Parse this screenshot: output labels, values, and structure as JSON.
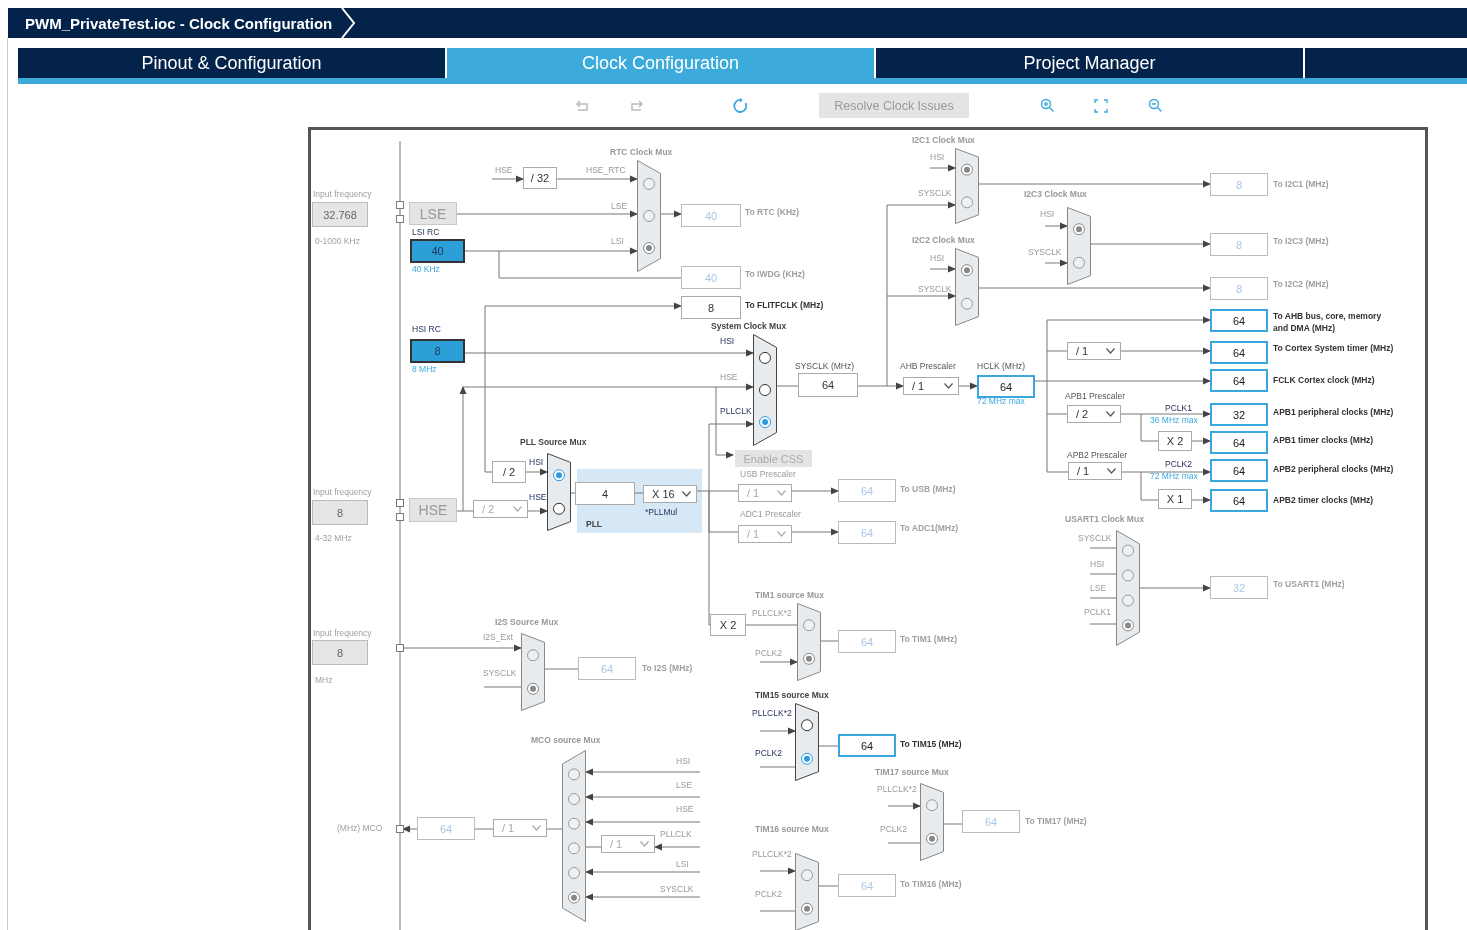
{
  "window": {
    "title": "PWM_PrivateTest.ioc - Clock Configuration"
  },
  "tabs": [
    {
      "label": "Pinout & Configuration",
      "selected": false
    },
    {
      "label": "Clock Configuration",
      "selected": true
    },
    {
      "label": "Project Manager",
      "selected": false
    }
  ],
  "toolbar": {
    "resolve_button": {
      "label": "Resolve Clock Issues",
      "disabled": true
    }
  },
  "diagram": {
    "labels": [
      {
        "text": "Input frequency",
        "kind": "hint"
      },
      {
        "text": "0-1000 KHz",
        "kind": "hint"
      },
      {
        "text": "RTC Clock Mux",
        "kind": "heading",
        "active": false
      },
      {
        "text": "HSE",
        "kind": "signal",
        "active": false
      },
      {
        "text": "HSE_RTC",
        "kind": "signal",
        "active": false
      },
      {
        "text": "LSE",
        "kind": "signal",
        "active": false
      },
      {
        "text": "LSI RC",
        "kind": "signal",
        "active": true
      },
      {
        "text": "LSI",
        "kind": "signal",
        "active": false
      },
      {
        "text": "40 KHz",
        "kind": "note"
      },
      {
        "text": "To RTC (KHz)",
        "kind": "dest",
        "active": false
      },
      {
        "text": "To IWDG (KHz)",
        "kind": "dest",
        "active": false
      },
      {
        "text": "To FLITFCLK (MHz)",
        "kind": "dest",
        "active": true
      },
      {
        "text": "HSI RC",
        "kind": "signal",
        "active": true
      },
      {
        "text": "System Clock Mux",
        "kind": "heading",
        "active": true
      },
      {
        "text": "8 MHz",
        "kind": "note"
      },
      {
        "text": "HSI",
        "kind": "signal",
        "active": true
      },
      {
        "text": "HSE",
        "kind": "signal",
        "active": false
      },
      {
        "text": "PLLCLK",
        "kind": "signal",
        "active": true
      },
      {
        "text": "SYSCLK (MHz)",
        "kind": "caption",
        "active": true
      },
      {
        "text": "AHB Prescaler",
        "kind": "caption",
        "active": true
      },
      {
        "text": "HCLK (MHz)",
        "kind": "caption",
        "active": true
      },
      {
        "text": "72 MHz max",
        "kind": "note"
      },
      {
        "text": "I2C1 Clock Mux",
        "kind": "heading",
        "active": false
      },
      {
        "text": "HSI",
        "kind": "signal",
        "active": false
      },
      {
        "text": "SYSCLK",
        "kind": "signal",
        "active": false
      },
      {
        "text": "I2C2 Clock Mux",
        "kind": "heading",
        "active": false
      },
      {
        "text": "HSI",
        "kind": "signal",
        "active": false
      },
      {
        "text": "SYSCLK",
        "kind": "signal",
        "active": false
      },
      {
        "text": "I2C3 Clock Mux",
        "kind": "heading",
        "active": false
      },
      {
        "text": "HSI",
        "kind": "signal",
        "active": false
      },
      {
        "text": "SYSCLK",
        "kind": "signal",
        "active": false
      },
      {
        "text": "To I2C1 (MHz)",
        "kind": "dest",
        "active": false
      },
      {
        "text": "To I2C3 (MHz)",
        "kind": "dest",
        "active": false
      },
      {
        "text": "To I2C2 (MHz)",
        "kind": "dest",
        "active": false
      },
      {
        "text": "To AHB bus, core, memory and DMA (MHz)",
        "kind": "dest",
        "active": true
      },
      {
        "text": "To Cortex System timer (MHz)",
        "kind": "dest",
        "active": true
      },
      {
        "text": "FCLK Cortex clock (MHz)",
        "kind": "dest",
        "active": true
      },
      {
        "text": "APB1 Prescaler",
        "kind": "caption",
        "active": true
      },
      {
        "text": "PCLK1",
        "kind": "signal",
        "active": true
      },
      {
        "text": "36 MHz max",
        "kind": "note"
      },
      {
        "text": "APB1 peripheral clocks (MHz)",
        "kind": "dest",
        "active": true
      },
      {
        "text": "APB1 timer clocks (MHz)",
        "kind": "dest",
        "active": true
      },
      {
        "text": "APB2 Prescaler",
        "kind": "caption",
        "active": true
      },
      {
        "text": "PCLK2",
        "kind": "signal",
        "active": true
      },
      {
        "text": "72 MHz max",
        "kind": "note"
      },
      {
        "text": "APB2 peripheral clocks (MHz)",
        "kind": "dest",
        "active": true
      },
      {
        "text": "APB2 timer clocks (MHz)",
        "kind": "dest",
        "active": true
      },
      {
        "text": "PLL Source Mux",
        "kind": "heading",
        "active": true
      },
      {
        "text": "HSI",
        "kind": "signal",
        "active": true
      },
      {
        "text": "HSE",
        "kind": "signal",
        "active": true
      },
      {
        "text": "*PLLMul",
        "kind": "signal",
        "active": true
      },
      {
        "text": "PLL",
        "kind": "heading",
        "active": true
      },
      {
        "text": "USB Prescaler",
        "kind": "caption",
        "active": false
      },
      {
        "text": "To USB (MHz)",
        "kind": "dest",
        "active": false
      },
      {
        "text": "ADC1 Prescaler",
        "kind": "caption",
        "active": false
      },
      {
        "text": "To ADC1(MHz)",
        "kind": "dest",
        "active": false
      },
      {
        "text": "Input frequency",
        "kind": "hint"
      },
      {
        "text": "4-32 MHz",
        "kind": "hint"
      },
      {
        "text": "USART1 Clock Mux",
        "kind": "heading",
        "active": false
      },
      {
        "text": "SYSCLK",
        "kind": "signal",
        "active": false
      },
      {
        "text": "HSI",
        "kind": "signal",
        "active": false
      },
      {
        "text": "LSE",
        "kind": "signal",
        "active": false
      },
      {
        "text": "PCLK1",
        "kind": "signal",
        "active": false
      },
      {
        "text": "To USART1 (MHz)",
        "kind": "dest",
        "active": false
      },
      {
        "text": "TIM1 source Mux",
        "kind": "heading",
        "active": false
      },
      {
        "text": "PLLCLK*2",
        "kind": "signal",
        "active": false
      },
      {
        "text": "PCLK2",
        "kind": "signal",
        "active": false
      },
      {
        "text": "To TIM1 (MHz)",
        "kind": "dest",
        "active": false
      },
      {
        "text": "Input frequency",
        "kind": "hint"
      },
      {
        "text": "MHz",
        "kind": "hint"
      },
      {
        "text": "I2S Source Mux",
        "kind": "heading",
        "active": false
      },
      {
        "text": "I2S_Ext",
        "kind": "signal",
        "active": false
      },
      {
        "text": "SYSCLK",
        "kind": "signal",
        "active": false
      },
      {
        "text": "To I2S (MHz)",
        "kind": "dest",
        "active": false
      },
      {
        "text": "TIM15 source Mux",
        "kind": "heading",
        "active": true
      },
      {
        "text": "PLLCLK*2",
        "kind": "signal",
        "active": true
      },
      {
        "text": "PCLK2",
        "kind": "signal",
        "active": true
      },
      {
        "text": "To TIM15 (MHz)",
        "kind": "dest",
        "active": true
      },
      {
        "text": "MCO source Mux",
        "kind": "heading",
        "active": false
      },
      {
        "text": "HSI",
        "kind": "signal",
        "active": false
      },
      {
        "text": "LSE",
        "kind": "signal",
        "active": false
      },
      {
        "text": "HSE",
        "kind": "signal",
        "active": false
      },
      {
        "text": "PLLCLK",
        "kind": "signal",
        "active": false
      },
      {
        "text": "LSI",
        "kind": "signal",
        "active": false
      },
      {
        "text": "SYSCLK",
        "kind": "signal",
        "active": false
      },
      {
        "text": "(MHz) MCO",
        "kind": "hint"
      },
      {
        "text": "TIM17 source Mux",
        "kind": "heading",
        "active": false
      },
      {
        "text": "PLLCLK*2",
        "kind": "signal",
        "active": false
      },
      {
        "text": "PCLK2",
        "kind": "signal",
        "active": false
      },
      {
        "text": "To TIM17 (MHz)",
        "kind": "dest",
        "active": false
      },
      {
        "text": "TIM16 source Mux",
        "kind": "heading",
        "active": false
      },
      {
        "text": "PLLCLK*2",
        "kind": "signal",
        "active": false
      },
      {
        "text": "PCLK2",
        "kind": "signal",
        "active": false
      },
      {
        "text": "To TIM16 (MHz)",
        "kind": "dest",
        "active": false
      }
    ],
    "boxes": [
      {
        "value": "32.768",
        "kind": "input"
      },
      {
        "value": "LSE",
        "kind": "source"
      },
      {
        "value": "40",
        "kind": "oscillator"
      },
      {
        "value": "/ 32",
        "kind": "divider"
      },
      {
        "value": "40",
        "kind": "value",
        "active": false
      },
      {
        "value": "40",
        "kind": "value",
        "active": false
      },
      {
        "value": "8",
        "kind": "plain"
      },
      {
        "value": "8",
        "kind": "oscillator"
      },
      {
        "value": "64",
        "kind": "plain"
      },
      {
        "value": "/ 1",
        "kind": "dropdown",
        "active": true
      },
      {
        "value": "64",
        "kind": "value",
        "active": true
      },
      {
        "value": "8",
        "kind": "value",
        "active": false
      },
      {
        "value": "8",
        "kind": "value",
        "active": false
      },
      {
        "value": "8",
        "kind": "value",
        "active": false
      },
      {
        "value": "64",
        "kind": "value",
        "active": true
      },
      {
        "value": "/ 1",
        "kind": "dropdown",
        "active": true
      },
      {
        "value": "64",
        "kind": "value",
        "active": true
      },
      {
        "value": "64",
        "kind": "value",
        "active": true
      },
      {
        "value": "/ 2",
        "kind": "dropdown",
        "active": true
      },
      {
        "value": "32",
        "kind": "value",
        "active": true
      },
      {
        "value": "X 2",
        "kind": "divider"
      },
      {
        "value": "64",
        "kind": "value",
        "active": true
      },
      {
        "value": "/ 1",
        "kind": "dropdown",
        "active": true
      },
      {
        "value": "64",
        "kind": "value",
        "active": true
      },
      {
        "value": "X 1",
        "kind": "divider"
      },
      {
        "value": "64",
        "kind": "value",
        "active": true
      },
      {
        "value": "/ 2",
        "kind": "divider"
      },
      {
        "value": "8",
        "kind": "input"
      },
      {
        "value": "HSE",
        "kind": "source"
      },
      {
        "value": "/ 2",
        "kind": "dropdown",
        "active": false
      },
      {
        "value": "4",
        "kind": "plain"
      },
      {
        "value": "X 16",
        "kind": "dropdown",
        "active": true
      },
      {
        "value": "/ 1",
        "kind": "dropdown",
        "active": false
      },
      {
        "value": "64",
        "kind": "value",
        "active": false
      },
      {
        "value": "/ 1",
        "kind": "dropdown",
        "active": false
      },
      {
        "value": "64",
        "kind": "value",
        "active": false
      },
      {
        "value": "32",
        "kind": "value",
        "active": false
      },
      {
        "value": "X 2",
        "kind": "divider"
      },
      {
        "value": "64",
        "kind": "value",
        "active": false
      },
      {
        "value": "8",
        "kind": "input"
      },
      {
        "value": "64",
        "kind": "value",
        "active": false
      },
      {
        "value": "64",
        "kind": "value",
        "active": true
      },
      {
        "value": "64",
        "kind": "value",
        "active": false
      },
      {
        "value": "/ 1",
        "kind": "dropdown",
        "active": false
      },
      {
        "value": "/ 1",
        "kind": "dropdown",
        "active": false
      },
      {
        "value": "64",
        "kind": "value",
        "active": false
      },
      {
        "value": "64",
        "kind": "value",
        "active": false
      }
    ],
    "muxes": [
      {
        "active": false,
        "options": [
          {
            "selected": false
          },
          {
            "selected": false
          },
          {
            "selected": true
          }
        ]
      },
      {
        "active": false,
        "options": [
          {
            "selected": true
          },
          {
            "selected": false
          }
        ]
      },
      {
        "active": false,
        "options": [
          {
            "selected": true
          },
          {
            "selected": false
          }
        ]
      },
      {
        "active": false,
        "options": [
          {
            "selected": true
          },
          {
            "selected": false
          }
        ]
      },
      {
        "active": true,
        "options": [
          {
            "selected": false
          },
          {
            "selected": false
          },
          {
            "selected": true
          }
        ]
      },
      {
        "active": true,
        "options": [
          {
            "selected": true
          },
          {
            "selected": false
          }
        ]
      },
      {
        "active": false,
        "options": [
          {
            "selected": false
          },
          {
            "selected": false
          },
          {
            "selected": false
          },
          {
            "selected": true
          }
        ]
      },
      {
        "active": false,
        "options": [
          {
            "selected": false
          },
          {
            "selected": true
          }
        ]
      },
      {
        "active": false,
        "options": [
          {
            "selected": false
          },
          {
            "selected": true
          }
        ]
      },
      {
        "active": true,
        "options": [
          {
            "selected": false
          },
          {
            "selected": true
          }
        ]
      },
      {
        "active": false,
        "options": [
          {
            "selected": false
          },
          {
            "selected": false
          },
          {
            "selected": false
          },
          {
            "selected": false
          },
          {
            "selected": false
          },
          {
            "selected": true
          }
        ]
      },
      {
        "active": false,
        "options": [
          {
            "selected": false
          },
          {
            "selected": true
          }
        ]
      },
      {
        "active": false,
        "options": [
          {
            "selected": false
          },
          {
            "selected": true
          }
        ]
      }
    ],
    "css_button": {
      "label": "Enable CSS",
      "disabled": true
    }
  }
}
